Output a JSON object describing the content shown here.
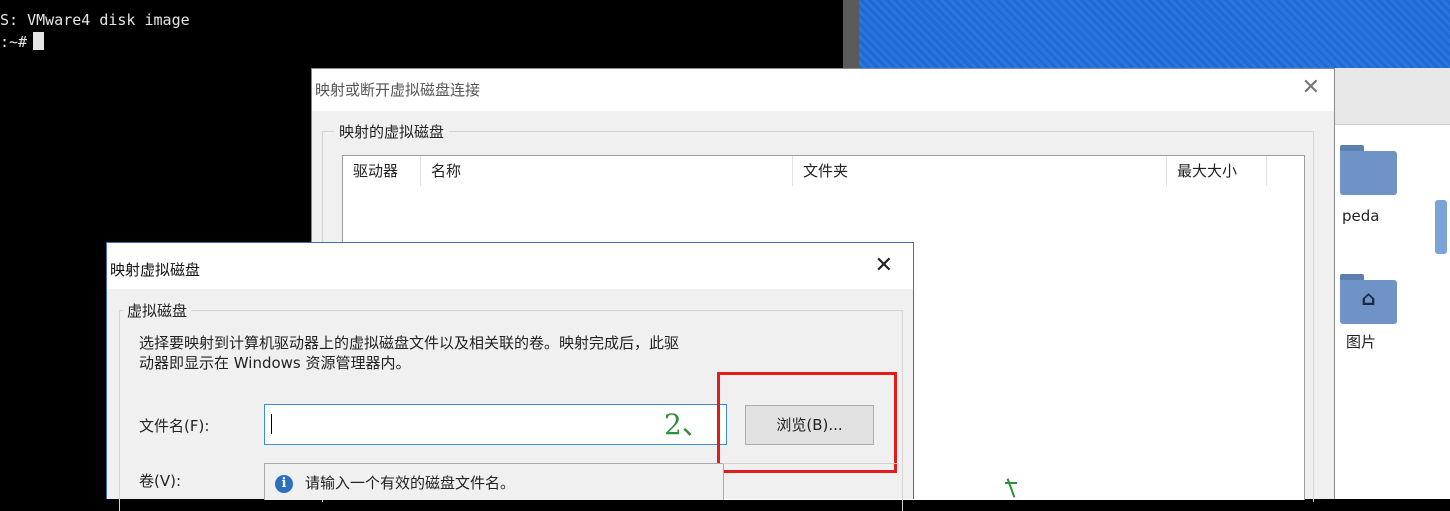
{
  "terminal": {
    "line1": "S: VMware4 disk image",
    "line2": ":~#"
  },
  "file_manager": {
    "folders": [
      {
        "label": "peda",
        "icon": "folder-icon"
      },
      {
        "label": "图片",
        "icon": "pictures-folder-icon"
      }
    ]
  },
  "dialog_main": {
    "title": "映射或断开虚拟磁盘连接",
    "group_label": "映射的虚拟磁盘",
    "columns": [
      "驱动器",
      "名称",
      "文件夹",
      "最大大小"
    ]
  },
  "dialog_map": {
    "title": "映射虚拟磁盘",
    "group_label": "虚拟磁盘",
    "description_line1": "选择要映射到计算机驱动器上的虚拟磁盘文件以及相关联的卷。映射完成后，此驱",
    "description_line2": "动器即显示在 Windows 资源管理器内。",
    "file_label": "文件名(F):",
    "file_value": "",
    "browse_label": "浏览(B)...",
    "volume_label": "卷(V):",
    "volume_message": "请输入一个有效的磁盘文件名。"
  },
  "annotations": {
    "step2": "2、"
  },
  "colors": {
    "highlight": "#e31b1b",
    "annotation": "#2f8f3a",
    "accent": "#3c8cd8"
  }
}
